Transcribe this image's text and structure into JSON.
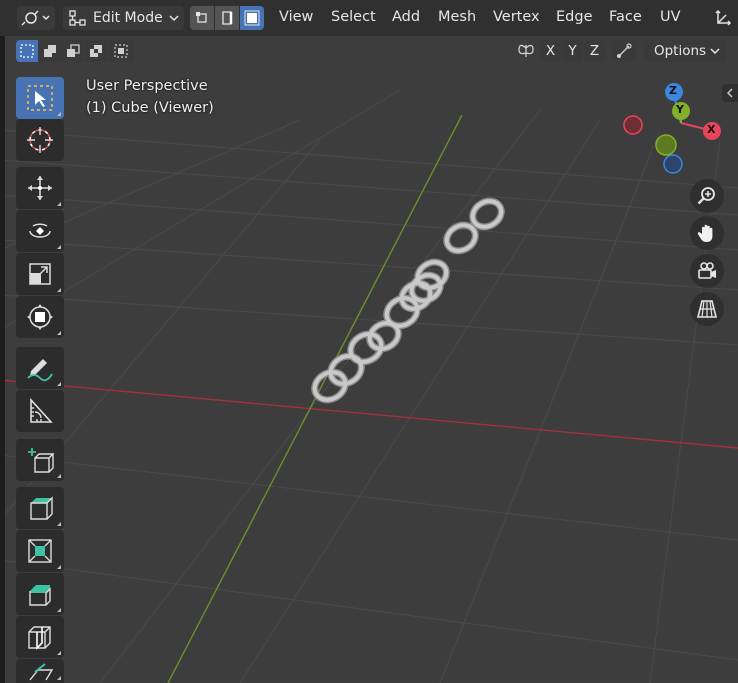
{
  "header": {
    "editor_type_icon": "workspace-icon",
    "mode_label": "Edit Mode",
    "select_modes": [
      "vertex-select",
      "edge-select",
      "face-select"
    ],
    "menu": [
      "View",
      "Select",
      "Add",
      "Mesh",
      "Vertex",
      "Edge",
      "Face",
      "UV"
    ]
  },
  "sub_header": {
    "mirror_axes": [
      "X",
      "Y",
      "Z"
    ],
    "options_label": "Options"
  },
  "viewport": {
    "view_name": "User Perspective",
    "object_name": "(1) Cube (Viewer)"
  },
  "gizmo": {
    "x_label": "X",
    "y_label": "Y",
    "z_label": "Z",
    "x_color": "#e8455a",
    "y_color": "#83b02a",
    "z_color": "#3b87e0"
  },
  "toolbar": [
    {
      "name": "select-box",
      "active": true
    },
    {
      "name": "cursor"
    },
    {
      "name": "move"
    },
    {
      "name": "rotate"
    },
    {
      "name": "scale"
    },
    {
      "name": "transform"
    },
    {
      "name": "annotate"
    },
    {
      "name": "measure"
    },
    {
      "name": "add-cube"
    },
    {
      "name": "extrude-region"
    },
    {
      "name": "inset-faces"
    },
    {
      "name": "bevel"
    },
    {
      "name": "loop-cut"
    },
    {
      "name": "knife"
    }
  ],
  "navigation": [
    "zoom",
    "pan",
    "camera-view",
    "toggle-perspective"
  ],
  "colors": {
    "x_axis_line": "#a3313b",
    "y_axis_line": "#6a8f2b",
    "grid": "#4a4a4a",
    "active_tool": "#4772b3",
    "ring": "#bdbdbd"
  }
}
